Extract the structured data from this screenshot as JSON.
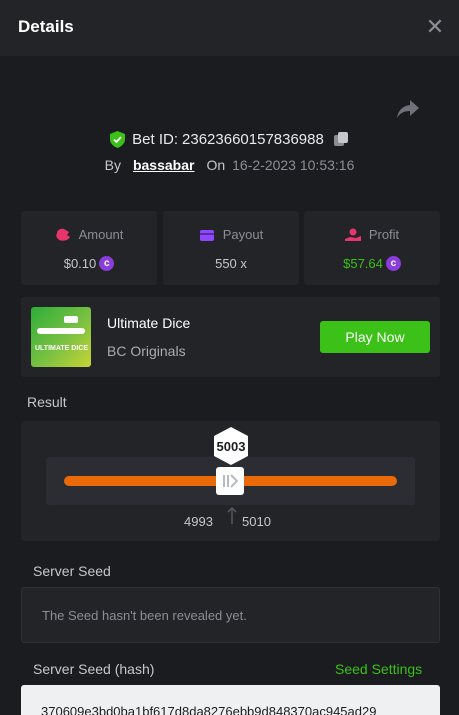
{
  "header": {
    "title": "Details",
    "close_icon": "close-icon"
  },
  "bet": {
    "id_label": "Bet ID:",
    "id": "23623660157836988",
    "by_label": "By",
    "user": "bassabar",
    "on_label": "On",
    "date": "16-2-2023 10:53:16"
  },
  "stats": {
    "amount": {
      "label": "Amount",
      "value": "$0.10",
      "icon": "amount-icon"
    },
    "payout": {
      "label": "Payout",
      "value": "550 x",
      "icon": "payout-icon"
    },
    "profit": {
      "label": "Profit",
      "value": "$57.64",
      "icon": "profit-icon"
    }
  },
  "game": {
    "name": "Ultimate Dice",
    "provider": "BC Originals",
    "play_label": "Play Now",
    "thumb_text": "ULTIMATE DICE"
  },
  "result": {
    "label": "Result",
    "roll": "5003",
    "range_low": "4993",
    "range_high": "5010"
  },
  "server_seed": {
    "label": "Server Seed",
    "placeholder": "The Seed hasn't been revealed yet."
  },
  "server_seed_hash": {
    "label": "Server Seed (hash)",
    "settings_label": "Seed Settings",
    "value": "370609e3bd0ba1bf617d8da8276ebb9d848370ac945ad29"
  },
  "colors": {
    "accent_green": "#3bc117",
    "slider_orange": "#ea6a0a",
    "amount_icon": "#e8356e",
    "payout_icon": "#9146ff",
    "profit_icon": "#e8356e",
    "coin": "#8a3ddb"
  }
}
